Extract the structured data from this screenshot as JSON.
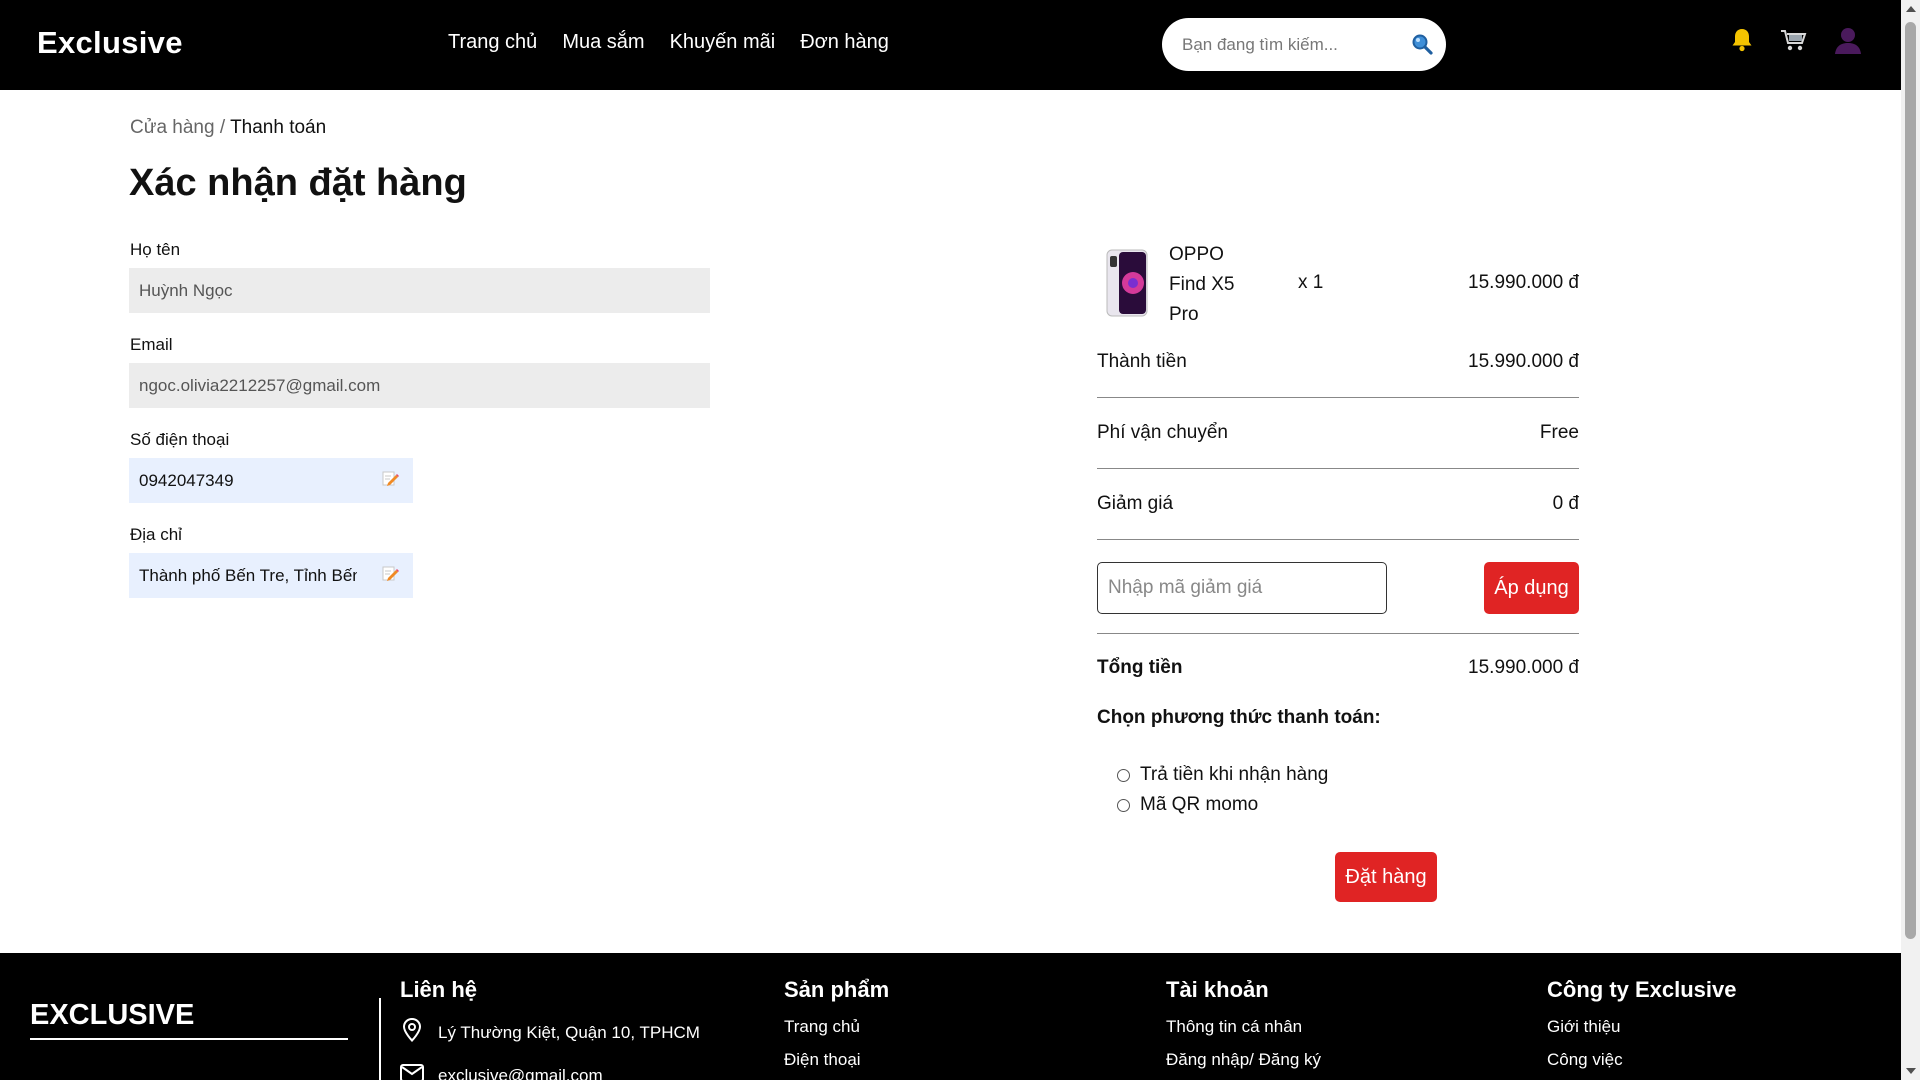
{
  "header": {
    "logo": "Exclusive",
    "nav": [
      "Trang chủ",
      "Mua sắm",
      "Khuyến mãi",
      "Đơn hàng"
    ],
    "search_placeholder": "Bạn đang tìm kiếm..."
  },
  "breadcrumb": {
    "parent": "Cửa hàng",
    "separator": " / ",
    "current": "Thanh toán"
  },
  "page_title": "Xác nhận đặt hàng",
  "form": {
    "name_label": "Họ tên",
    "name_value": "Huỳnh Ngọc",
    "email_label": "Email",
    "email_value": "ngoc.olivia2212257@gmail.com",
    "phone_label": "Số điện thoại",
    "phone_value": "0942047349",
    "address_label": "Địa chỉ",
    "address_value": "Thành phố Bến Tre, Tỉnh Bến Tre"
  },
  "order": {
    "product_name": "OPPO Find X5 Pro",
    "quantity": "x 1",
    "product_price": "15.990.000 đ",
    "subtotal_label": "Thành tiền",
    "subtotal_value": "15.990.000 đ",
    "shipping_label": "Phí vận chuyển",
    "shipping_value": "Free",
    "discount_label": "Giảm giá",
    "discount_value": "0 đ",
    "coupon_placeholder": "Nhập mã giảm giá",
    "apply_label": "Áp dụng",
    "total_label": "Tổng tiền",
    "total_value": "15.990.000 đ",
    "payment_title": "Chọn phương thức thanh toán:",
    "payment_options": [
      "Trả tiền khi nhận hàng",
      "Mã QR momo"
    ],
    "place_order_label": "Đặt hàng"
  },
  "footer": {
    "logo": "EXCLUSIVE",
    "contact_title": "Liên hệ",
    "contact_address": "Lý Thường Kiệt, Quận 10, TPHCM",
    "contact_email": "exclusive@gmail.com",
    "products_title": "Sản phẩm",
    "products_links": [
      "Trang chủ",
      "Điện thoại"
    ],
    "account_title": "Tài khoản",
    "account_links": [
      "Thông tin cá nhân",
      "Đăng nhập/ Đăng ký"
    ],
    "company_title": "Công ty Exclusive",
    "company_links": [
      "Giới thiệu",
      "Công việc"
    ]
  },
  "colors": {
    "accent_red": "#e02424",
    "header_bg": "#000000",
    "bell": "#f5c400",
    "avatar": "#4a1a5c"
  },
  "icons": [
    "search-icon",
    "bell-icon",
    "cart-icon",
    "user-icon",
    "edit-icon",
    "location-icon",
    "mail-icon"
  ]
}
